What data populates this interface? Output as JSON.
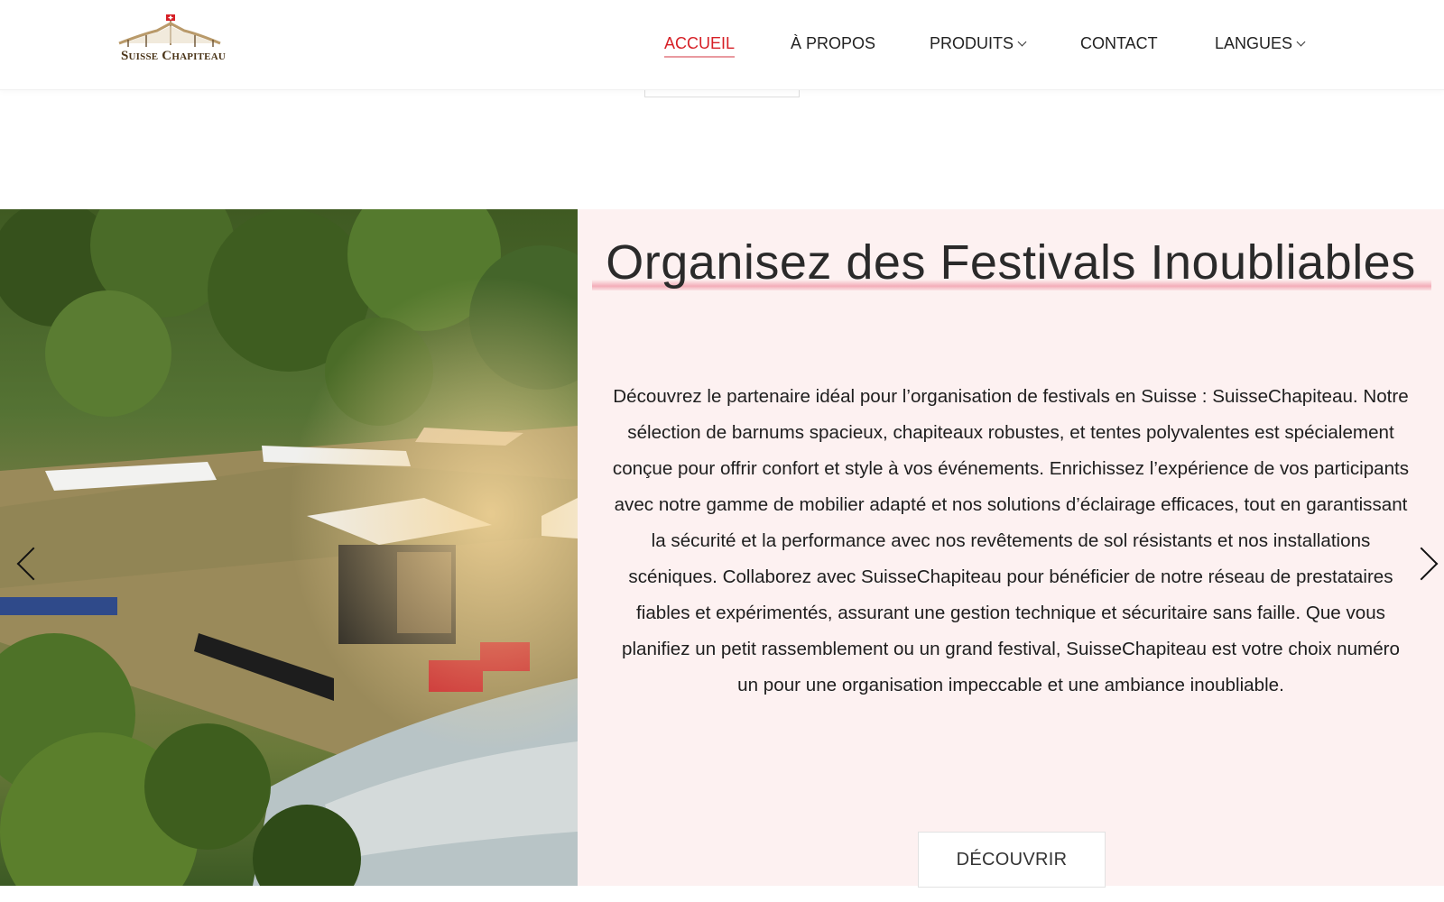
{
  "header": {
    "logo_text": "Suisse Chapiteau",
    "nav": [
      {
        "label": "ACCUEIL",
        "active": true,
        "dropdown": false
      },
      {
        "label": "À PROPOS",
        "active": false,
        "dropdown": false
      },
      {
        "label": "PRODUITS",
        "active": false,
        "dropdown": true
      },
      {
        "label": "CONTACT",
        "active": false,
        "dropdown": false
      },
      {
        "label": "LANGUES",
        "active": false,
        "dropdown": true
      }
    ]
  },
  "hero": {
    "title": "Organisez des Festivals Inoubliables",
    "text": "Découvrez le partenaire idéal pour l’organisation de festivals en Suisse : SuisseChapiteau. Notre sélection de barnums spacieux, chapiteaux robustes, et tentes polyvalentes est spécialement conçue pour offrir confort et style à vos événements. Enrichissez l’expérience de vos participants avec notre gamme de mobilier adapté et nos solutions d’éclairage efficaces, tout en garantissant la sécurité et la performance avec nos revêtements de sol résistants et nos installations scéniques. Collaborez avec SuisseChapiteau pour bénéficier de notre réseau de prestataires fiables et expérimentés, assurant une gestion technique et sécuritaire sans faille. Que vous planifiez un petit rassemblement ou un grand festival, SuisseChapiteau est votre choix numéro un pour une organisation impeccable et une ambiance inoubliable.",
    "button_label": "DÉCOUVRIR"
  },
  "colors": {
    "accent": "#d61f26",
    "panel_bg": "#fdf1f1",
    "underline": "#f096a5"
  },
  "icons": [
    "chevron-down-icon",
    "chevron-left-icon",
    "chevron-right-icon",
    "logo-tent-icon"
  ]
}
